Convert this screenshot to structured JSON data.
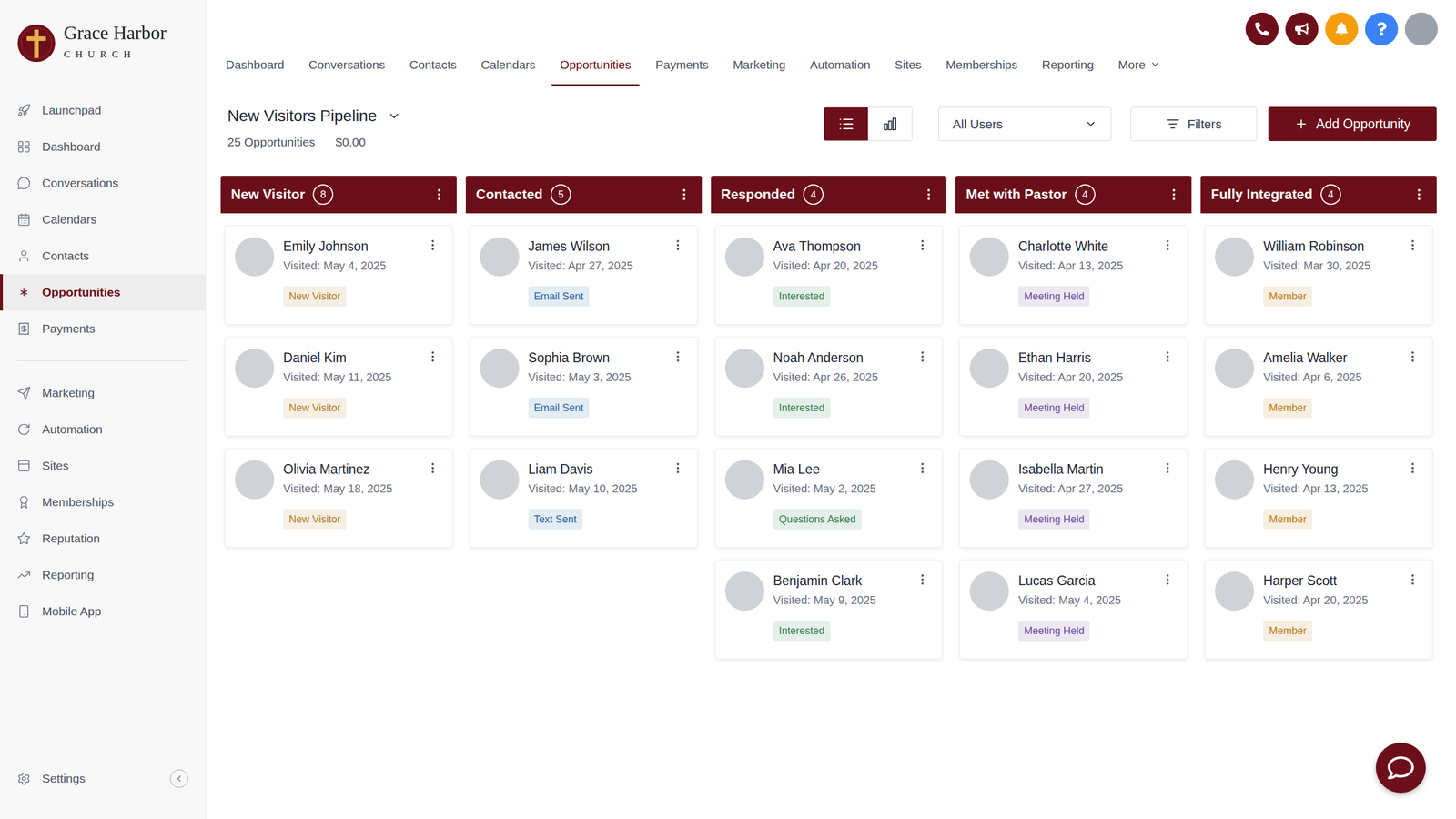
{
  "brand": {
    "name": "Grace Harbor",
    "sub": "CHURCH"
  },
  "nav": [
    {
      "label": "Dashboard",
      "selected": false,
      "kind": "link"
    },
    {
      "label": "Conversations",
      "selected": false,
      "kind": "link"
    },
    {
      "label": "Contacts",
      "selected": false,
      "kind": "link"
    },
    {
      "label": "Calendars",
      "selected": false,
      "kind": "link"
    },
    {
      "label": "Opportunities",
      "selected": true,
      "kind": "link"
    },
    {
      "label": "Payments",
      "selected": false,
      "kind": "link"
    },
    {
      "label": "Marketing",
      "selected": false,
      "kind": "link"
    },
    {
      "label": "Automation",
      "selected": false,
      "kind": "link"
    },
    {
      "label": "Sites",
      "selected": false,
      "kind": "link"
    },
    {
      "label": "Memberships",
      "selected": false,
      "kind": "link"
    },
    {
      "label": "Reporting",
      "selected": false,
      "kind": "link"
    },
    {
      "label": "More",
      "selected": false,
      "kind": "menu"
    }
  ],
  "sidebar": {
    "primary": [
      {
        "label": "Launchpad",
        "selected": false
      },
      {
        "label": "Dashboard",
        "selected": false
      },
      {
        "label": "Conversations",
        "selected": false
      },
      {
        "label": "Calendars",
        "selected": false
      },
      {
        "label": "Contacts",
        "selected": false
      },
      {
        "label": "Opportunities",
        "selected": true
      },
      {
        "label": "Payments",
        "selected": false
      }
    ],
    "secondary": [
      {
        "label": "Marketing",
        "selected": false
      },
      {
        "label": "Automation",
        "selected": false
      },
      {
        "label": "Sites",
        "selected": false
      },
      {
        "label": "Memberships",
        "selected": false
      },
      {
        "label": "Reputation",
        "selected": false
      },
      {
        "label": "Reporting",
        "selected": false
      },
      {
        "label": "Mobile App",
        "selected": false
      }
    ],
    "settings": "Settings"
  },
  "pipeline": {
    "name": "New Visitors Pipeline",
    "count": "25 Opportunities",
    "value": "$0.00"
  },
  "view": [
    {
      "selected": true
    },
    {
      "selected": false
    }
  ],
  "userFilter": "All Users",
  "filters": "Filters",
  "add": "Add Opportunity",
  "columns": [
    {
      "title": "New Visitor",
      "count": "8",
      "cards": [
        {
          "name": "Emily Johnson",
          "visited": "Visited: May 4, 2025",
          "tag": "New Visitor",
          "color": "#b7791f"
        },
        {
          "name": "Daniel Kim",
          "visited": "Visited: May 11, 2025",
          "tag": "New Visitor",
          "color": "#b7791f"
        },
        {
          "name": "Olivia Martinez",
          "visited": "Visited: May 18, 2025",
          "tag": "New Visitor",
          "color": "#b7791f"
        }
      ]
    },
    {
      "title": "Contacted",
      "count": "5",
      "cards": [
        {
          "name": "James Wilson",
          "visited": "Visited: Apr 27, 2025",
          "tag": "Email Sent",
          "color": "#2563a8"
        },
        {
          "name": "Sophia Brown",
          "visited": "Visited: May 3, 2025",
          "tag": "Email Sent",
          "color": "#2563a8"
        },
        {
          "name": "Liam Davis",
          "visited": "Visited: May 10, 2025",
          "tag": "Text Sent",
          "color": "#2563a8"
        }
      ]
    },
    {
      "title": "Responded",
      "count": "4",
      "cards": [
        {
          "name": "Ava Thompson",
          "visited": "Visited: Apr 20, 2025",
          "tag": "Interested",
          "color": "#2f7d4a"
        },
        {
          "name": "Noah Anderson",
          "visited": "Visited: Apr 26, 2025",
          "tag": "Interested",
          "color": "#2f7d4a"
        },
        {
          "name": "Mia Lee",
          "visited": "Visited: May 2, 2025",
          "tag": "Questions Asked",
          "color": "#2f7d4a"
        },
        {
          "name": "Benjamin Clark",
          "visited": "Visited: May 9, 2025",
          "tag": "Interested",
          "color": "#2f7d4a"
        }
      ]
    },
    {
      "title": "Met with Pastor",
      "count": "4",
      "cards": [
        {
          "name": "Charlotte White",
          "visited": "Visited: Apr 13, 2025",
          "tag": "Meeting Held",
          "color": "#6a4a9c"
        },
        {
          "name": "Ethan Harris",
          "visited": "Visited: Apr 20, 2025",
          "tag": "Meeting Held",
          "color": "#6a4a9c"
        },
        {
          "name": "Isabella Martin",
          "visited": "Visited: Apr 27, 2025",
          "tag": "Meeting Held",
          "color": "#6a4a9c"
        },
        {
          "name": "Lucas Garcia",
          "visited": "Visited: May 4, 2025",
          "tag": "Meeting Held",
          "color": "#6a4a9c"
        }
      ]
    },
    {
      "title": "Fully Integrated",
      "count": "4",
      "cards": [
        {
          "name": "William Robinson",
          "visited": "Visited: Mar 30, 2025",
          "tag": "Member",
          "color": "#c0780e"
        },
        {
          "name": "Amelia Walker",
          "visited": "Visited: Apr 6, 2025",
          "tag": "Member",
          "color": "#c0780e"
        },
        {
          "name": "Henry Young",
          "visited": "Visited: Apr 13, 2025",
          "tag": "Member",
          "color": "#c0780e"
        },
        {
          "name": "Harper Scott",
          "visited": "Visited: Apr 20, 2025",
          "tag": "Member",
          "color": "#c0780e"
        }
      ]
    }
  ]
}
